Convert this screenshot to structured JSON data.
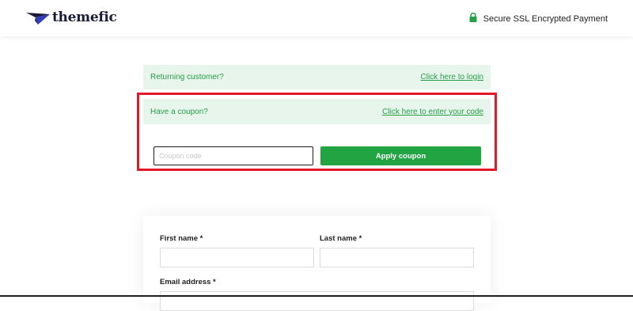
{
  "header": {
    "brand_name": "themefic",
    "logo_icon": "paper-plane-icon",
    "secure_icon": "lock-icon",
    "secure_text": "Secure SSL Encrypted Payment"
  },
  "notices": {
    "returning_label": "Returning customer?",
    "returning_link": "Click here to login",
    "coupon_label": "Have a coupon?",
    "coupon_link": "Click here to enter your code"
  },
  "coupon_form": {
    "placeholder": "Coupon code",
    "value": "",
    "button_label": "Apply coupon"
  },
  "billing": {
    "first_name_label": "First name *",
    "last_name_label": "Last name *",
    "email_label": "Email address *"
  },
  "colors": {
    "accent_green": "#23a443",
    "notice_bg": "#e8f5ec",
    "highlight_red": "#e3192a",
    "brand_navy": "#1a1a3a"
  }
}
